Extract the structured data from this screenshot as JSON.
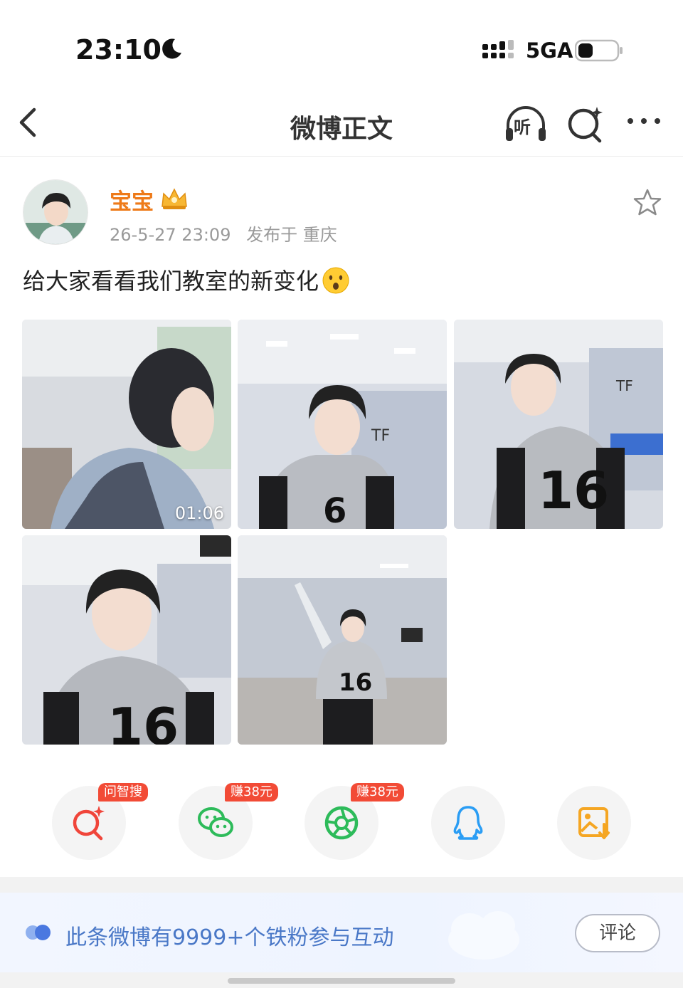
{
  "status_bar": {
    "time": "23:10",
    "network": "5GA",
    "icons": [
      "moon-icon",
      "signal-icon",
      "battery-icon"
    ]
  },
  "nav": {
    "title": "微博正文",
    "listen_label": "听",
    "icons": [
      "back-arrow-icon",
      "headphones-icon",
      "ai-search-icon",
      "more-icon"
    ]
  },
  "post": {
    "username": "宝宝",
    "username_color": "#ee7a19",
    "date": "26-5-27 23:09",
    "location": "发布于 重庆",
    "text": "给大家看看我们教室的新变化",
    "emoji": "hushed-face-emoji",
    "video_duration": "01:06",
    "image_count": 5
  },
  "share": {
    "items": [
      {
        "name": "ai-search",
        "badge": "问智搜",
        "color": "#f0453a"
      },
      {
        "name": "wechat",
        "badge": "赚38元",
        "color": "#2dbb5a"
      },
      {
        "name": "moments",
        "badge": "赚38元",
        "color": "#2dbb5a"
      },
      {
        "name": "qq",
        "badge": "",
        "color": "#2a9df4"
      },
      {
        "name": "save-image",
        "badge": "",
        "color": "#f5a623"
      }
    ],
    "badge_color": "#f24b36"
  },
  "fan_bar": {
    "text": "此条微博有9999+个铁粉参与互动",
    "comment_label": "评论",
    "accent": "#4a78c7"
  }
}
